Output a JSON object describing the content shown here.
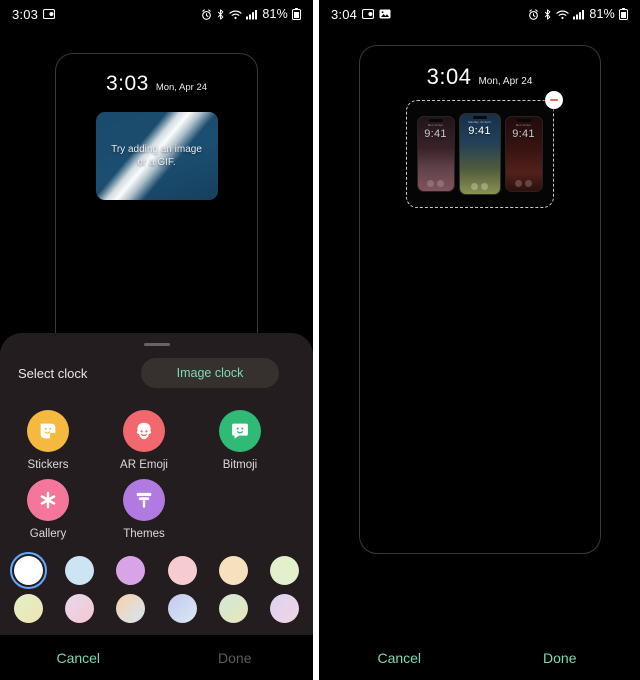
{
  "left": {
    "statusbar": {
      "time": "3:03",
      "left_icons": [
        "screenshot-icon"
      ],
      "right_icons": [
        "alarm-icon",
        "bluetooth-icon",
        "wifi-icon",
        "signal-icon"
      ],
      "battery_percent": "81%"
    },
    "lockscreen": {
      "time": "3:03",
      "date": "Mon, Apr 24",
      "placeholder_text": "Try adding an image or a GIF."
    },
    "sheet": {
      "title": "Select clock",
      "chip_label": "Image clock",
      "tiles": [
        {
          "label": "Stickers",
          "icon": "sticker-icon",
          "color": "#f6b940"
        },
        {
          "label": "AR Emoji",
          "icon": "ar-emoji-icon",
          "color": "#f2686f"
        },
        {
          "label": "Bitmoji",
          "icon": "bitmoji-icon",
          "color": "#2fba77"
        },
        {
          "label": "Gallery",
          "icon": "gallery-flower-icon",
          "color": "#f4769b"
        },
        {
          "label": "Themes",
          "icon": "themes-roller-icon",
          "color": "#b07ae0"
        }
      ],
      "swatches_row1": [
        "#ffffff",
        "#cde4f5",
        "#d9a3e8",
        "#f7ccd0",
        "#f7e0bd",
        "#e2f0cd"
      ],
      "swatches_row2": [
        "#e9e6bd",
        "#efd6dd",
        "#f6d7b8",
        "#c9cef0",
        "#cfeadf",
        "#dcd2f2"
      ],
      "selected_swatch_index": 0
    },
    "actions": {
      "cancel": "Cancel",
      "done": "Done",
      "done_enabled": false
    }
  },
  "right": {
    "statusbar": {
      "time": "3:04",
      "left_icons": [
        "screenshot-icon",
        "image-icon"
      ],
      "right_icons": [
        "alarm-icon",
        "bluetooth-icon",
        "wifi-icon",
        "signal-icon"
      ],
      "battery_percent": "81%"
    },
    "lockscreen": {
      "time": "3:04",
      "date": "Mon, Apr 24",
      "widget": {
        "remove_label": "remove-icon",
        "phones": [
          {
            "top_text": "Mon 24 Apr",
            "time": "9:41"
          },
          {
            "top_text": "Monday, 24 April",
            "time": "9:41"
          },
          {
            "top_text": "Mon 24 Apr",
            "time": "9:41"
          }
        ]
      }
    },
    "actions": {
      "cancel": "Cancel",
      "done": "Done",
      "done_enabled": true
    }
  },
  "colors": {
    "accent": "#7fd9b2",
    "sheet_bg": "#231d1f",
    "disabled": "#5c5c5c",
    "selection_ring": "#63a9ff",
    "remove_red": "#e06a5a"
  }
}
